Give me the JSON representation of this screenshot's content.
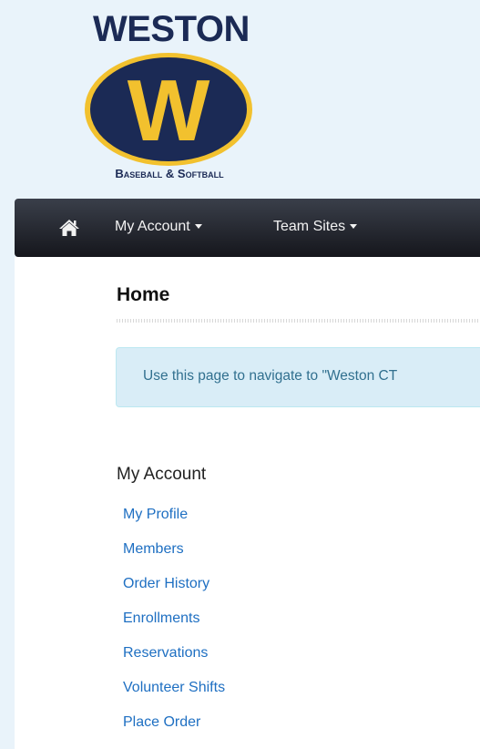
{
  "logo": {
    "word": "WESTON",
    "letter": "W",
    "subtitle": "Baseball & Softball",
    "colors": {
      "navy": "#1b2a55",
      "gold": "#f2c12e"
    }
  },
  "navbar": {
    "home_icon": "home-icon",
    "items": [
      {
        "label": "My Account"
      },
      {
        "label": "Team Sites"
      }
    ]
  },
  "page": {
    "title": "Home",
    "alert_text": "Use this page to navigate to \"Weston CT"
  },
  "account": {
    "heading": "My Account",
    "links": [
      {
        "label": "My Profile"
      },
      {
        "label": "Members"
      },
      {
        "label": "Order History"
      },
      {
        "label": "Enrollments"
      },
      {
        "label": "Reservations"
      },
      {
        "label": "Volunteer Shifts"
      },
      {
        "label": "Place Order"
      }
    ]
  }
}
